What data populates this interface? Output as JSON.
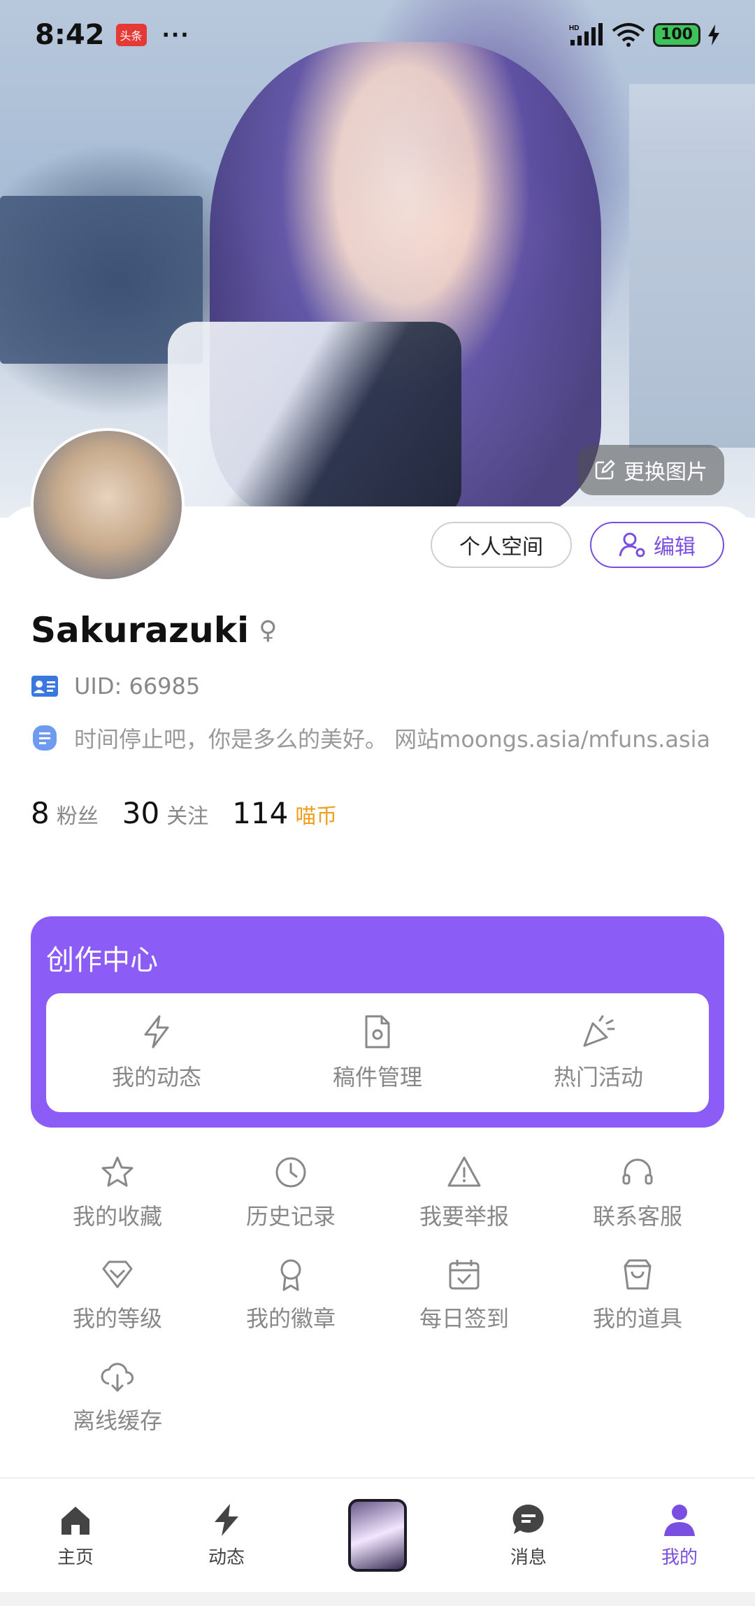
{
  "status_bar": {
    "time": "8:42",
    "news_badge": "头条",
    "more": "···",
    "battery": "100"
  },
  "header": {
    "change_picture_label": "更换图片"
  },
  "profile": {
    "space_button": "个人空间",
    "edit_button": "编辑",
    "username": "Sakurazuki",
    "gender_symbol": "♀",
    "uid": "UID: 66985",
    "bio": "时间停止吧，你是多么的美好。 网站moongs.asia/mfuns.asia",
    "stats": [
      {
        "value": "8",
        "label": "粉丝"
      },
      {
        "value": "30",
        "label": "关注"
      },
      {
        "value": "114",
        "label": "喵币"
      }
    ]
  },
  "creator_center": {
    "title": "创作中心",
    "items": [
      {
        "label": "我的动态",
        "icon": "lightning-icon"
      },
      {
        "label": "稿件管理",
        "icon": "file-gear-icon"
      },
      {
        "label": "热门活动",
        "icon": "party-popper-icon"
      }
    ]
  },
  "grid": [
    {
      "label": "我的收藏",
      "icon": "star-icon"
    },
    {
      "label": "历史记录",
      "icon": "clock-icon"
    },
    {
      "label": "我要举报",
      "icon": "warning-icon"
    },
    {
      "label": "联系客服",
      "icon": "headphones-icon"
    },
    {
      "label": "我的等级",
      "icon": "diamond-icon"
    },
    {
      "label": "我的徽章",
      "icon": "badge-icon"
    },
    {
      "label": "每日签到",
      "icon": "calendar-check-icon"
    },
    {
      "label": "我的道具",
      "icon": "bag-icon"
    },
    {
      "label": "离线缓存",
      "icon": "cloud-download-icon"
    }
  ],
  "tabbar": [
    {
      "label": "主页",
      "icon": "home-icon"
    },
    {
      "label": "动态",
      "icon": "lightning-icon"
    },
    {
      "label": "",
      "icon": "center-avatar"
    },
    {
      "label": "消息",
      "icon": "chat-icon"
    },
    {
      "label": "我的",
      "icon": "user-icon"
    }
  ],
  "colors": {
    "accent": "#8b5cf6",
    "coin": "#f0a020"
  }
}
